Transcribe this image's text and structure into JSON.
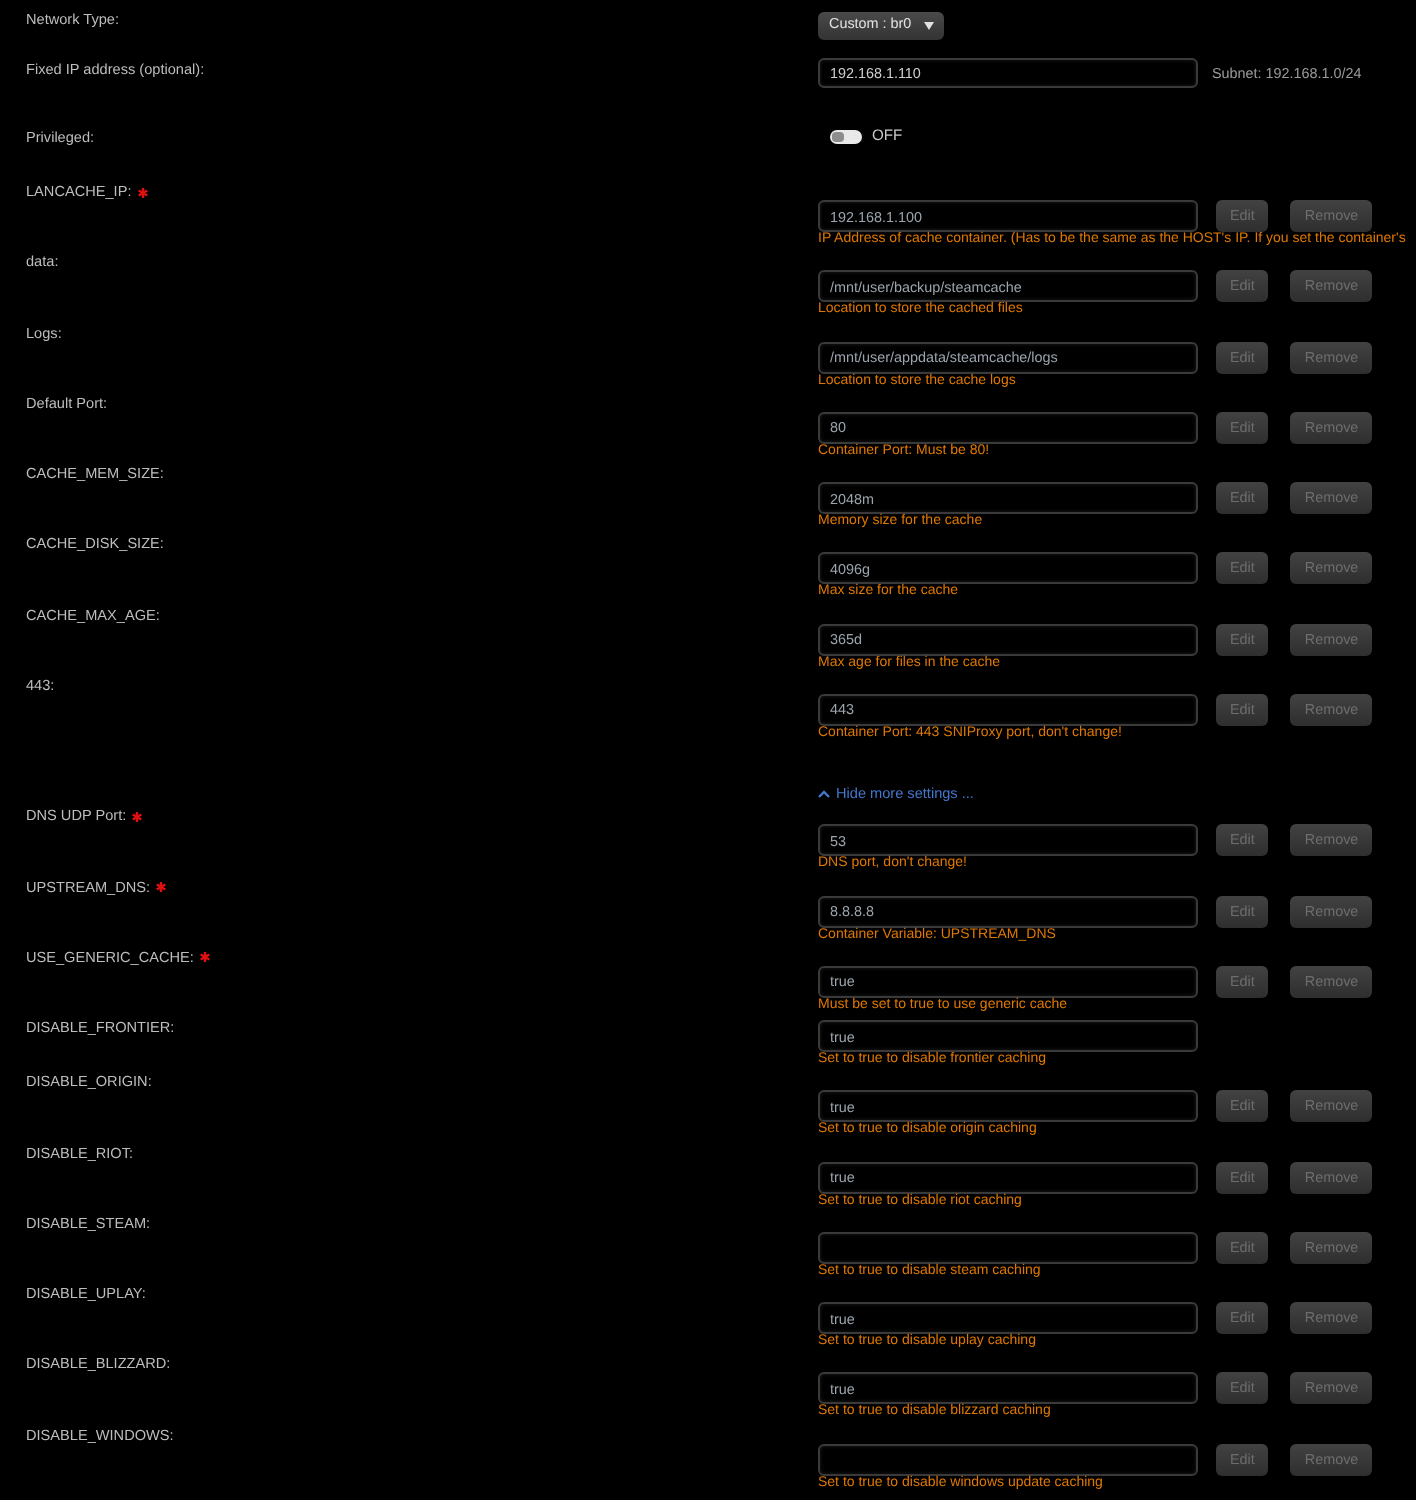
{
  "network_type": {
    "label": "Network Type:",
    "value": "Custom : br0"
  },
  "fixed_ip": {
    "label": "Fixed IP address (optional):",
    "value": "192.168.1.110",
    "note": "Subnet: 192.168.1.0/24"
  },
  "privileged": {
    "label": "Privileged:",
    "on": false,
    "state_text": "OFF"
  },
  "settings": [
    {
      "label": "LANCACHE_IP:",
      "required": true,
      "value": "192.168.1.100",
      "description": "IP Address of cache container. (Has to be the same as the HOST's IP. If you set the container's",
      "buttons": [
        {
          "label": "Edit",
          "disabled": true
        },
        {
          "label": "Remove",
          "disabled": true
        }
      ]
    },
    {
      "label": "data:",
      "required": false,
      "value": "/mnt/user/backup/steamcache",
      "description": "Location to store the cached files",
      "buttons": [
        {
          "label": "Edit",
          "disabled": true
        },
        {
          "label": "Remove",
          "disabled": true
        }
      ]
    },
    {
      "label": "Logs:",
      "required": false,
      "value": "/mnt/user/appdata/steamcache/logs",
      "description": "Location to store the cache logs",
      "buttons": [
        {
          "label": "Edit",
          "disabled": true
        },
        {
          "label": "Remove",
          "disabled": true
        }
      ]
    },
    {
      "label": "Default Port:",
      "required": false,
      "value": "80",
      "description": "Container Port: Must be 80!",
      "buttons": [
        {
          "label": "Edit",
          "disabled": true
        },
        {
          "label": "Remove",
          "disabled": true
        }
      ]
    },
    {
      "label": "CACHE_MEM_SIZE:",
      "required": false,
      "value": "2048m",
      "description": "Memory size for the cache",
      "buttons": [
        {
          "label": "Edit",
          "disabled": true
        },
        {
          "label": "Remove",
          "disabled": true
        }
      ]
    },
    {
      "label": "CACHE_DISK_SIZE:",
      "required": false,
      "value": "4096g",
      "description": "Max size for the cache",
      "buttons": [
        {
          "label": "Edit",
          "disabled": true
        },
        {
          "label": "Remove",
          "disabled": true
        }
      ]
    },
    {
      "label": "CACHE_MAX_AGE:",
      "required": false,
      "value": "365d",
      "description": "Max age for files in the cache",
      "buttons": [
        {
          "label": "Edit",
          "disabled": true
        },
        {
          "label": "Remove",
          "disabled": true
        }
      ]
    },
    {
      "label": "443:",
      "required": false,
      "value": "443",
      "description": "Container Port: 443 SNIProxy port, don't change!",
      "buttons": [
        {
          "label": "Edit",
          "disabled": true
        },
        {
          "label": "Remove",
          "disabled": true
        }
      ]
    }
  ],
  "more_toggle": {
    "text": "Hide more settings ...",
    "expanded": true
  },
  "more_settings": [
    {
      "label": "DNS UDP Port:",
      "required": true,
      "value": "53",
      "description": "DNS port, don't change!",
      "buttons": [
        {
          "label": "Edit",
          "disabled": true
        },
        {
          "label": "Remove",
          "disabled": true
        }
      ]
    },
    {
      "label": "UPSTREAM_DNS:",
      "required": true,
      "value": "8.8.8.8",
      "description": "Container Variable: UPSTREAM_DNS",
      "buttons": [
        {
          "label": "Edit",
          "disabled": true
        },
        {
          "label": "Remove",
          "disabled": true
        }
      ]
    },
    {
      "label": "USE_GENERIC_CACHE:",
      "required": true,
      "value": "true",
      "description": "Must be set to true to use generic cache",
      "buttons": [
        {
          "label": "Edit",
          "disabled": true
        },
        {
          "label": "Remove",
          "disabled": true
        }
      ]
    },
    {
      "label": "DISABLE_FRONTIER:",
      "required": false,
      "value": "true",
      "description": "Set to true to disable frontier caching"
    },
    {
      "label": "DISABLE_ORIGIN:",
      "required": false,
      "value": "true",
      "description": "Set to true to disable origin caching",
      "buttons": [
        {
          "label": "Edit",
          "disabled": true
        },
        {
          "label": "Remove",
          "disabled": true
        }
      ]
    },
    {
      "label": "DISABLE_RIOT:",
      "required": false,
      "value": "true",
      "description": "Set to true to disable riot caching",
      "buttons": [
        {
          "label": "Edit",
          "disabled": true
        },
        {
          "label": "Remove",
          "disabled": true
        }
      ]
    },
    {
      "label": "DISABLE_STEAM:",
      "required": false,
      "description": "Set to true to disable steam caching",
      "buttons": [
        {
          "label": "Edit",
          "disabled": true
        },
        {
          "label": "Remove",
          "disabled": true
        }
      ]
    },
    {
      "label": "DISABLE_UPLAY:",
      "required": false,
      "value": "true",
      "description": "Set to true to disable uplay caching",
      "buttons": [
        {
          "label": "Edit",
          "disabled": true
        },
        {
          "label": "Remove",
          "disabled": true
        }
      ]
    },
    {
      "label": "DISABLE_BLIZZARD:",
      "required": false,
      "value": "true",
      "description": "Set to true to disable blizzard caching",
      "buttons": [
        {
          "label": "Edit",
          "disabled": true
        },
        {
          "label": "Remove",
          "disabled": true
        }
      ]
    },
    {
      "label": "DISABLE_WINDOWS:",
      "required": false,
      "description": "Set to true to disable windows update caching",
      "buttons": [
        {
          "label": "Edit",
          "disabled": true
        },
        {
          "label": "Remove",
          "disabled": true
        }
      ]
    }
  ]
}
